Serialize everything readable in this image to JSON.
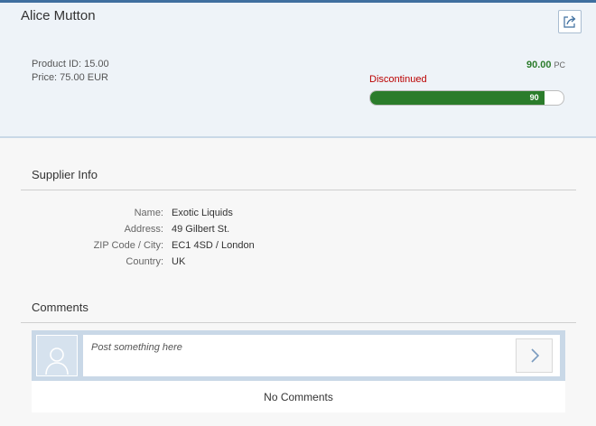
{
  "header": {
    "title": "Alice Mutton",
    "product_id": "Product ID: 15.00",
    "price": "Price: 75.00 EUR",
    "quantity": "90.00",
    "unit": "PC",
    "status": "Discontinued",
    "stock_percent": 90,
    "stock_label": "90",
    "share_icon": "share-icon"
  },
  "supplier": {
    "title": "Supplier Info",
    "fields": [
      {
        "label": "Name:",
        "value": "Exotic Liquids"
      },
      {
        "label": "Address:",
        "value": "49 Gilbert St."
      },
      {
        "label": "ZIP Code / City:",
        "value": "EC1 4SD / London"
      },
      {
        "label": "Country:",
        "value": "UK"
      }
    ]
  },
  "comments": {
    "title": "Comments",
    "placeholder": "Post something here",
    "empty_text": "No Comments",
    "avatar_icon": "person-icon",
    "post_icon": "chevron-right-icon"
  },
  "colors": {
    "accent_bar": "#3f6f9f",
    "positive": "#2b7c2b",
    "negative": "#bb0000"
  }
}
